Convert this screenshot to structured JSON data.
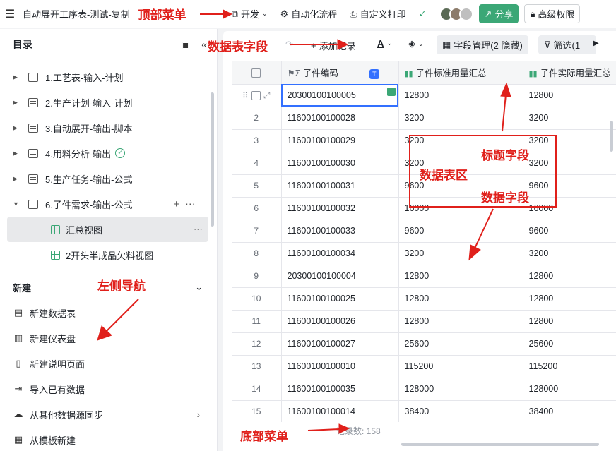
{
  "topbar": {
    "title": "自动展开工序表-测试-复制",
    "dev": "开发",
    "automation": "自动化流程",
    "print": "自定义打印",
    "share": "分享",
    "permission": "高级权限"
  },
  "sidebar": {
    "header": "目录",
    "tree": [
      {
        "label": "1.工艺表-输入-计划",
        "expanded": false
      },
      {
        "label": "2.生产计划-输入-计划",
        "expanded": false
      },
      {
        "label": "3.自动展开-输出-脚本",
        "expanded": false
      },
      {
        "label": "4.用料分析-输出",
        "expanded": false,
        "badge": "ok"
      },
      {
        "label": "5.生产任务-输出-公式",
        "expanded": false
      },
      {
        "label": "6.子件需求-输出-公式",
        "expanded": true
      }
    ],
    "views": [
      {
        "label": "汇总视图",
        "active": true
      },
      {
        "label": "2开头半成品欠料视图",
        "active": false
      }
    ],
    "new_section": "新建",
    "new_items": [
      {
        "label": "新建数据表",
        "icon": "table-icon"
      },
      {
        "label": "新建仪表盘",
        "icon": "dashboard-icon"
      },
      {
        "label": "新建说明页面",
        "icon": "page-icon"
      },
      {
        "label": "导入已有数据",
        "icon": "import-icon"
      },
      {
        "label": "从其他数据源同步",
        "icon": "cloud-icon",
        "chevron": true
      },
      {
        "label": "从模板新建",
        "icon": "template-icon"
      }
    ]
  },
  "toolbar": {
    "add_record": "添加记录",
    "fields": "字段管理(2 隐藏)",
    "filter": "筛选(1"
  },
  "table": {
    "columns": [
      "子件编码",
      "子件标准用量汇总",
      "子件实际用量汇总"
    ],
    "rows": [
      {
        "n": "",
        "code": "20300100100005",
        "std": "12800",
        "act": "12800"
      },
      {
        "n": "2",
        "code": "11600100100028",
        "std": "3200",
        "act": "3200"
      },
      {
        "n": "3",
        "code": "11600100100029",
        "std": "3200",
        "act": "3200"
      },
      {
        "n": "4",
        "code": "11600100100030",
        "std": "3200",
        "act": "3200"
      },
      {
        "n": "5",
        "code": "11600100100031",
        "std": "9600",
        "act": "9600"
      },
      {
        "n": "6",
        "code": "11600100100032",
        "std": "16000",
        "act": "16000"
      },
      {
        "n": "7",
        "code": "11600100100033",
        "std": "9600",
        "act": "9600"
      },
      {
        "n": "8",
        "code": "11600100100034",
        "std": "3200",
        "act": "3200"
      },
      {
        "n": "9",
        "code": "20300100100004",
        "std": "12800",
        "act": "12800"
      },
      {
        "n": "10",
        "code": "11600100100025",
        "std": "12800",
        "act": "12800"
      },
      {
        "n": "11",
        "code": "11600100100026",
        "std": "12800",
        "act": "12800"
      },
      {
        "n": "12",
        "code": "11600100100027",
        "std": "25600",
        "act": "25600"
      },
      {
        "n": "13",
        "code": "11600100100010",
        "std": "115200",
        "act": "115200"
      },
      {
        "n": "14",
        "code": "11600100100035",
        "std": "128000",
        "act": "128000"
      },
      {
        "n": "15",
        "code": "11600100100014",
        "std": "38400",
        "act": "38400"
      }
    ],
    "count": "记录数: 158"
  },
  "annotations": {
    "top_menu": "顶部菜单",
    "table_fields": "数据表字段",
    "title_field": "标题字段",
    "table_area": "数据表区",
    "data_field": "数据字段",
    "left_nav": "左侧导航",
    "bottom_menu": "底部菜单"
  },
  "colors": {
    "accent": "#3ba776",
    "annotation": "#e0201b",
    "select": "#3370ff"
  }
}
